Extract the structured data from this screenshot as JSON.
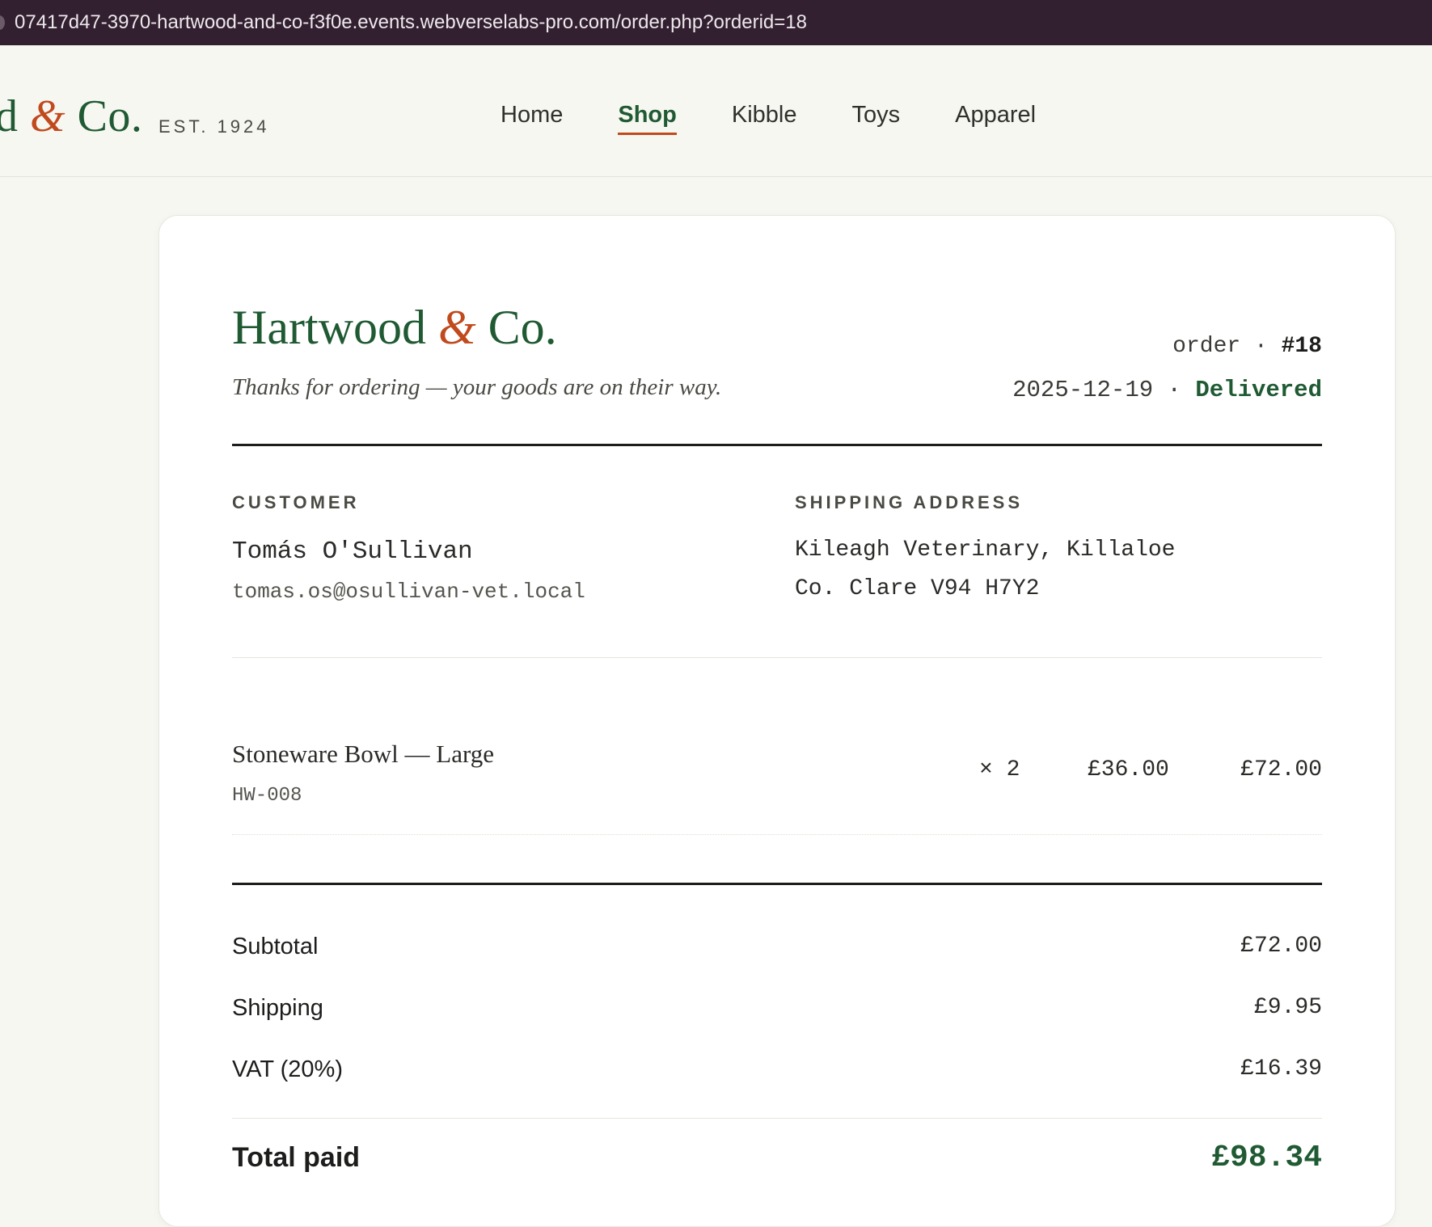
{
  "browser": {
    "url": "07417d47-3970-hartwood-and-co-f3f0e.events.webverselabs-pro.com/order.php?orderid=18"
  },
  "header": {
    "brand_visible_start": "d ",
    "brand_amp": "&",
    "brand_visible_end": " Co.",
    "est": "EST. 1924",
    "nav": [
      {
        "label": "Home",
        "active": false
      },
      {
        "label": "Shop",
        "active": true
      },
      {
        "label": "Kibble",
        "active": false
      },
      {
        "label": "Toys",
        "active": false
      },
      {
        "label": "Apparel",
        "active": false
      }
    ]
  },
  "receipt": {
    "brand_name": "Hartwood ",
    "brand_amp": "&",
    "brand_suffix": " Co.",
    "tagline": "Thanks for ordering — your goods are on their way.",
    "order_label": "order · ",
    "order_number": "#18",
    "date": "2025-12-19 · ",
    "status": "Delivered",
    "customer_label": "CUSTOMER",
    "customer_name": "Tomás O'Sullivan",
    "customer_email": "tomas.os@osullivan-vet.local",
    "shipping_label": "SHIPPING ADDRESS",
    "address_line1": "Kileagh Veterinary, Killaloe",
    "address_line2": "Co. Clare V94 H7Y2",
    "items": [
      {
        "name": "Stoneware Bowl — Large",
        "sku": "HW-008",
        "qty": "× 2",
        "unit_price": "£36.00",
        "line_total": "£72.00"
      }
    ],
    "summary": {
      "subtotal_label": "Subtotal",
      "subtotal": "£72.00",
      "shipping_label": "Shipping",
      "shipping": "£9.95",
      "vat_label": "VAT (20%)",
      "vat": "£16.39",
      "total_label": "Total paid",
      "total": "£98.34"
    }
  }
}
